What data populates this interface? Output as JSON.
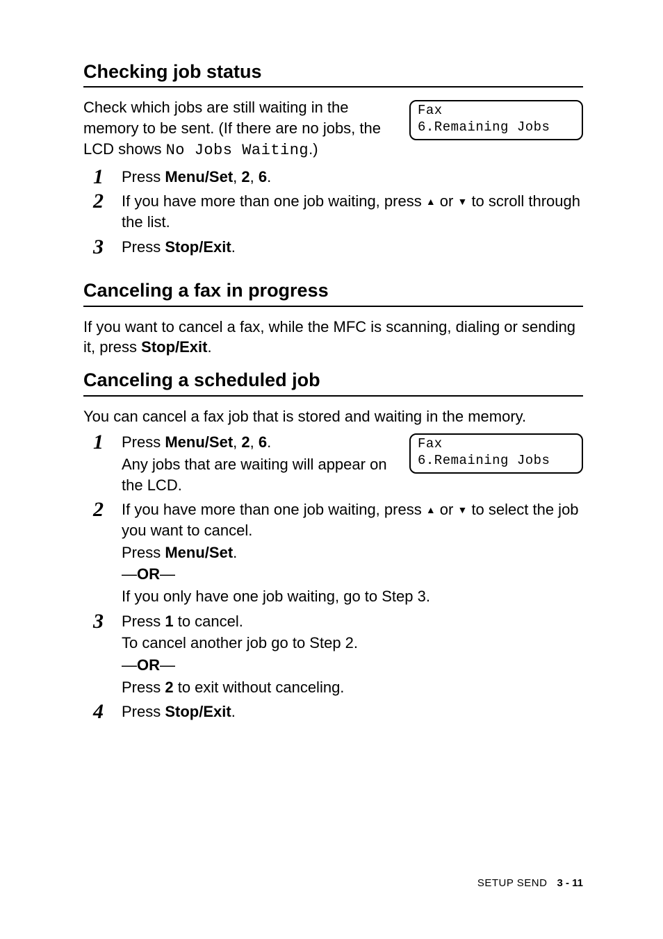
{
  "sec1": {
    "title": "Checking job status",
    "intro_1": "Check which jobs are still waiting in the memory to be sent. (If there are no jobs, the LCD shows ",
    "intro_mono": "No Jobs Waiting",
    "intro_2": ".)",
    "lcd_l1": "Fax",
    "lcd_l2": "6.Remaining Jobs",
    "step1_pre": "Press ",
    "step1_b": "Menu/Set",
    "step1_post": ", ",
    "step1_b2": "2",
    "step1_post2": ", ",
    "step1_b3": "6",
    "step1_dot": ".",
    "step2_a": "If you have more than one job waiting, press ",
    "step2_b": " or ",
    "step2_c": " to scroll through the list.",
    "step3_pre": "Press ",
    "step3_b": "Stop/Exit",
    "step3_dot": "."
  },
  "sec2": {
    "title": "Canceling a fax in progress",
    "p1_a": "If you want to cancel a fax, while the MFC is scanning, dialing or sending it, press ",
    "p1_b": "Stop/Exit",
    "p1_c": "."
  },
  "sec3": {
    "title": "Canceling a scheduled job",
    "intro": "You can cancel a fax job that is stored and waiting in the memory.",
    "lcd_l1": "Fax",
    "lcd_l2": "6.Remaining Jobs",
    "s1_pre": "Press ",
    "s1_b": "Menu/Set",
    "s1_post": ", ",
    "s1_b2": "2",
    "s1_post2": ", ",
    "s1_b3": "6",
    "s1_dot": ".",
    "s1_p2": "Any jobs that are waiting will appear on the LCD.",
    "s2_a": "If you have more than one job waiting, press ",
    "s2_b": " or ",
    "s2_c": " to select the job you want to cancel.",
    "s2_press": "Press ",
    "s2_ms": "Menu/Set",
    "s2_dot": ".",
    "or_dash": "—",
    "or_text": "OR",
    "s2_alt": "If you only have one job waiting, go to Step 3.",
    "s3_pre": "Press ",
    "s3_b": "1",
    "s3_post": " to cancel.",
    "s3_p2": "To cancel another job go to Step 2.",
    "s3_alt_pre": "Press ",
    "s3_alt_b": "2",
    "s3_alt_post": " to exit without canceling.",
    "s4_pre": "Press ",
    "s4_b": "Stop/Exit",
    "s4_dot": "."
  },
  "footer": {
    "setup": "SETUP SEND",
    "pagenum": "3 - 11"
  },
  "glyph": {
    "up": "▲",
    "down": "▼"
  },
  "num": {
    "1": "1",
    "2": "2",
    "3": "3",
    "4": "4"
  }
}
